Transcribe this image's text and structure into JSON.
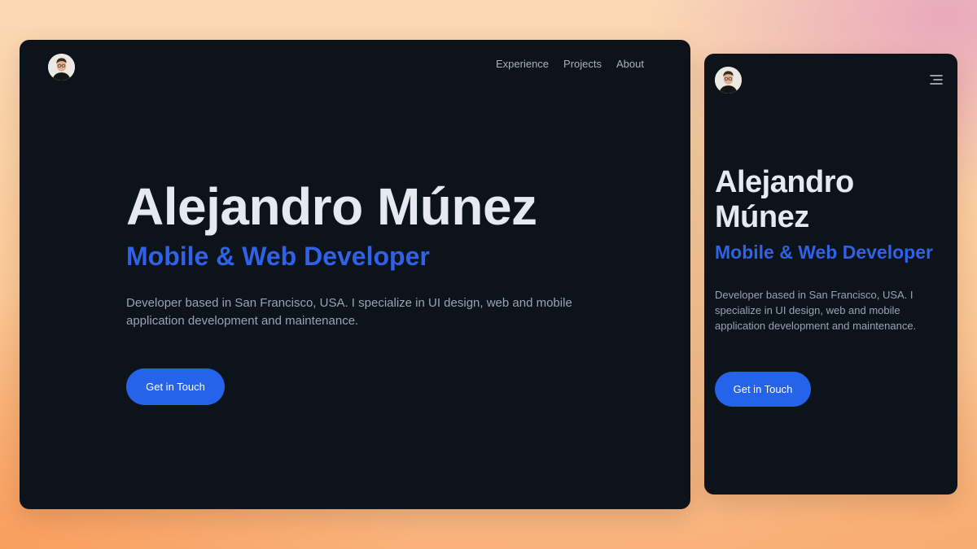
{
  "desktop": {
    "nav": {
      "items": [
        {
          "label": "Experience"
        },
        {
          "label": "Projects"
        },
        {
          "label": "About"
        }
      ]
    },
    "hero": {
      "name": "Alejandro Múnez",
      "role": "Mobile & Web Developer",
      "description": "Developer based in San Francisco, USA. I specialize in UI design, web and mobile application development and maintenance.",
      "cta_label": "Get in Touch"
    }
  },
  "mobile": {
    "hero": {
      "name": "Alejandro Múnez",
      "role": "Mobile & Web Developer",
      "description": "Developer based in San Francisco, USA. I specialize in UI design, web and mobile application development and maintenance.",
      "cta_label": "Get in Touch"
    }
  },
  "icons": {
    "avatar": "avatar-portrait",
    "menu": "hamburger-menu-icon"
  },
  "colors": {
    "background_frame": "#0d131b",
    "name_text": "#e6e9ef",
    "accent": "#2563eb",
    "body_text": "#9aa3b0",
    "nav_text": "#a9b1bd"
  }
}
